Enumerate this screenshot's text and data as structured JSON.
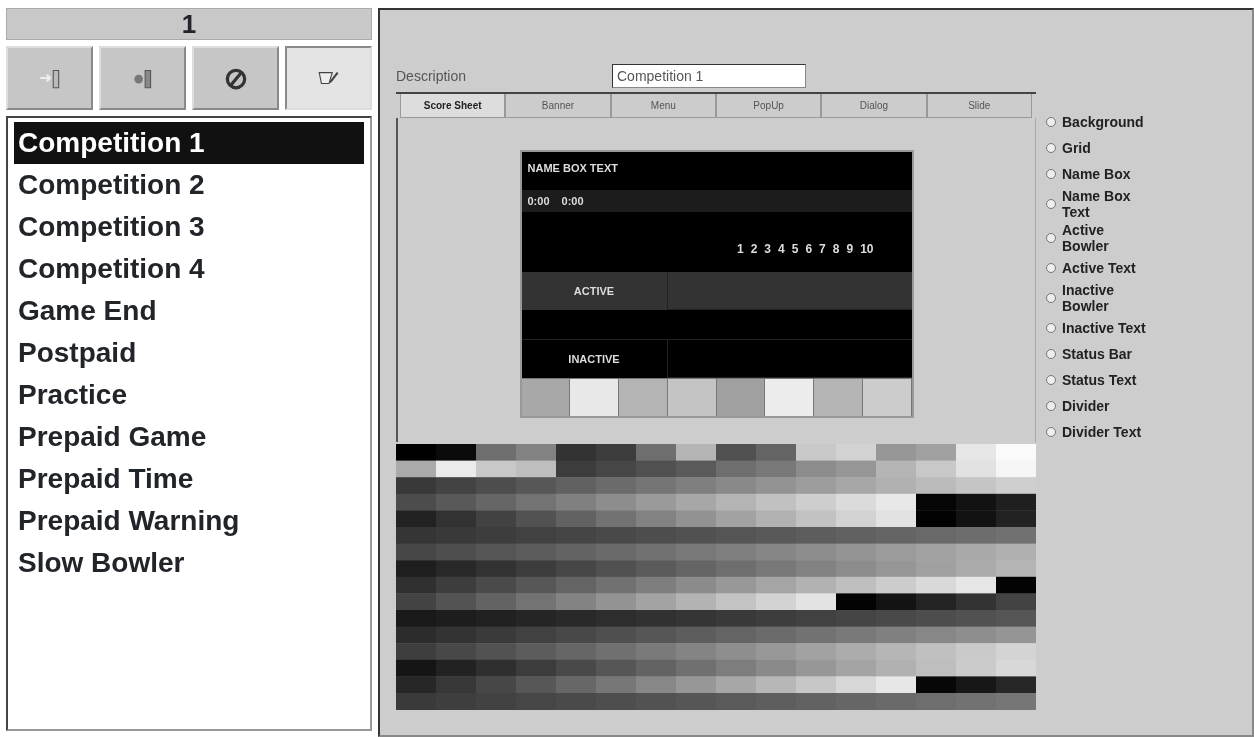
{
  "header": {
    "title": "1"
  },
  "toolbar": [
    {
      "kind": "enter",
      "pressed": false
    },
    {
      "kind": "exit",
      "pressed": false
    },
    {
      "kind": "block",
      "pressed": false
    },
    {
      "kind": "edit",
      "pressed": true
    }
  ],
  "list": [
    {
      "label": "Competition 1",
      "selected": true
    },
    {
      "label": "Competition 2",
      "selected": false
    },
    {
      "label": "Competition 3",
      "selected": false
    },
    {
      "label": "Competition 4",
      "selected": false
    },
    {
      "label": "Game End",
      "selected": false
    },
    {
      "label": "Postpaid",
      "selected": false
    },
    {
      "label": "Practice",
      "selected": false
    },
    {
      "label": "Prepaid Game",
      "selected": false
    },
    {
      "label": "Prepaid Time",
      "selected": false
    },
    {
      "label": "Prepaid Warning",
      "selected": false
    },
    {
      "label": "Slow Bowler",
      "selected": false
    }
  ],
  "description": {
    "label": "Description",
    "value": "Competition 1"
  },
  "tabs": [
    {
      "label": "Score Sheet",
      "selected": true
    },
    {
      "label": "Banner",
      "selected": false
    },
    {
      "label": "Menu",
      "selected": false
    },
    {
      "label": "PopUp",
      "selected": false
    },
    {
      "label": "Dialog",
      "selected": false
    },
    {
      "label": "Slide",
      "selected": false
    }
  ],
  "preview": {
    "name_box_text": "NAME BOX TEXT",
    "times": [
      "0:00",
      "0:00"
    ],
    "frames": [
      "1",
      "2",
      "3",
      "4",
      "5",
      "6",
      "7",
      "8",
      "9",
      "10"
    ],
    "active_label": "ACTIVE",
    "inactive_label": "INACTIVE",
    "status_swatches": [
      {
        "color": "#a8a8a8"
      },
      {
        "color": "#e8e8e8"
      },
      {
        "color": "#b4b4b4"
      },
      {
        "color": "#c4c4c4"
      },
      {
        "color": "#a0a0a0"
      },
      {
        "color": "#ececec"
      },
      {
        "color": "#b4b4b4"
      },
      {
        "color": "#cccccc"
      }
    ]
  },
  "elements": [
    {
      "label": "Background",
      "selected": false
    },
    {
      "label": "Grid",
      "selected": false
    },
    {
      "label": "Name Box",
      "selected": false
    },
    {
      "label": "Name Box Text",
      "selected": false
    },
    {
      "label": "Active Bowler",
      "selected": false
    },
    {
      "label": "Active Text",
      "selected": false
    },
    {
      "label": "Inactive Bowler",
      "selected": false
    },
    {
      "label": "Inactive Text",
      "selected": false
    },
    {
      "label": "Status Bar",
      "selected": false
    },
    {
      "label": "Status Text",
      "selected": false
    },
    {
      "label": "Divider",
      "selected": false
    },
    {
      "label": "Divider Text",
      "selected": false
    }
  ]
}
